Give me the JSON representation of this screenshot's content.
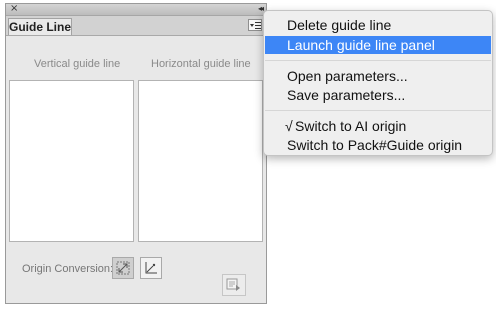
{
  "panel": {
    "tab_title": "Guide Line",
    "close_glyph": "×",
    "collapse_glyph": "◂◂",
    "vertical_header": "Vertical guide line",
    "horizontal_header": "Horizontal guide line",
    "origin_label": "Origin Conversion:",
    "icons": {
      "menu": "panel-menu-icon",
      "origin_diagonal": "origin-diagonal-icon",
      "origin_corner": "origin-corner-icon",
      "bottom": "panel-footer-icon"
    }
  },
  "menu": {
    "items": [
      {
        "label": "Delete guide line",
        "highlighted": false
      },
      {
        "label": "Launch guide line panel",
        "highlighted": true
      },
      {
        "label": "Open parameters...",
        "highlighted": false
      },
      {
        "label": "Save parameters...",
        "highlighted": false
      },
      {
        "label": "Switch to AI origin",
        "checked": true,
        "check_glyph": "√"
      },
      {
        "label": "Switch to Pack#Guide origin",
        "checked": false
      }
    ],
    "highlight_color": "#3d86f6"
  }
}
